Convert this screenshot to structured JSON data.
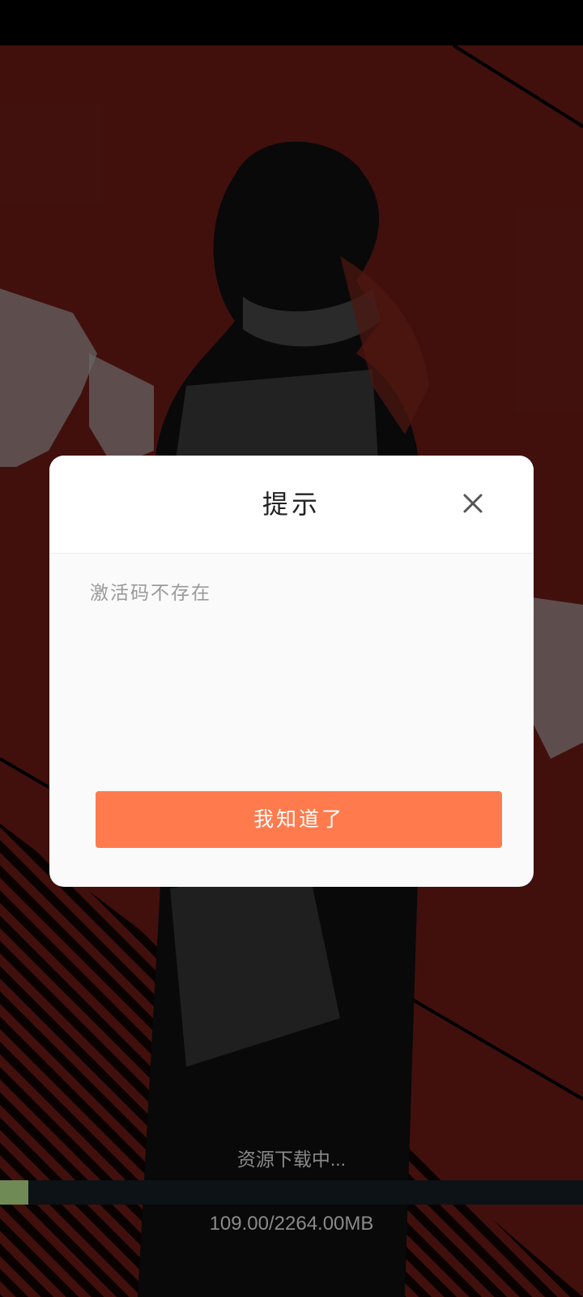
{
  "dialog": {
    "title": "提示",
    "message": "激活码不存在",
    "confirm_label": "我知道了",
    "close_icon": "close-icon"
  },
  "download": {
    "status_text": "资源下载中...",
    "size_text": "109.00/2264.00MB",
    "progress_fraction": 0.0481,
    "fill_color": "#6f8a55"
  },
  "colors": {
    "background": "#4a130f",
    "accent_button": "#ff7a4c"
  }
}
